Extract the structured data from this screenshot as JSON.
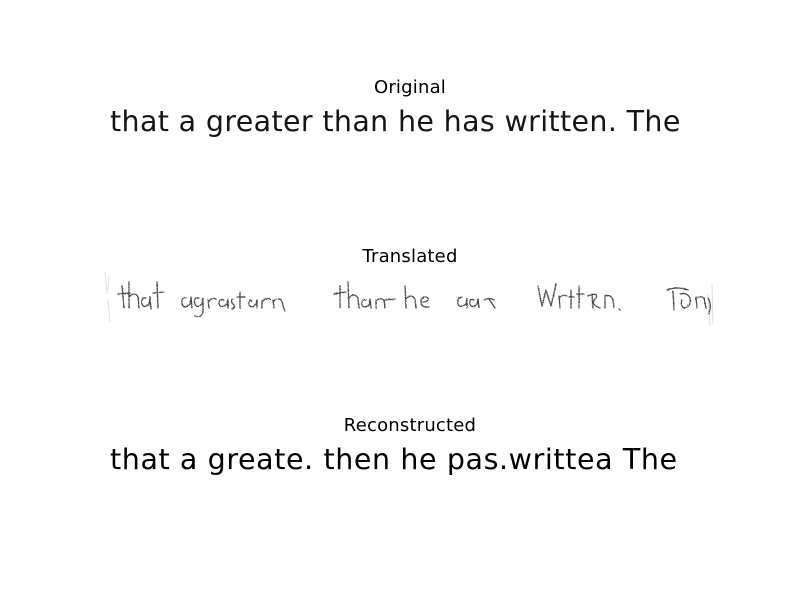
{
  "panels": [
    {
      "title": "Original",
      "image_text": "that a greater than he has written. The"
    },
    {
      "title": "Translated",
      "image_text": "that a greater than he has written. The"
    },
    {
      "title": "Reconstructed",
      "image_text": "that a greate. then he pas.writtea  The"
    }
  ]
}
